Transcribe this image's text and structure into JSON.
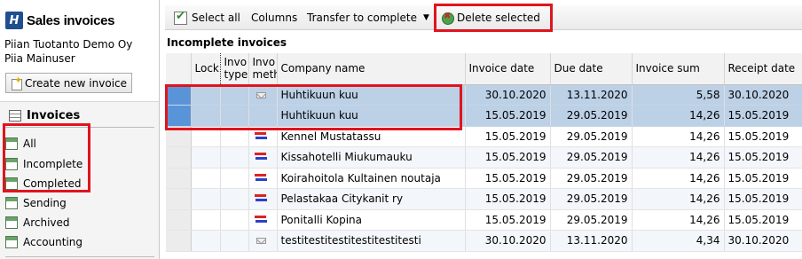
{
  "app": {
    "logo_letter": "H",
    "title": "Sales invoices",
    "company": "Piian Tuotanto Demo Oy",
    "user": "Piia Mainuser",
    "create_button": "Create new invoice"
  },
  "nav": {
    "header": "Invoices",
    "items": [
      {
        "label": "All"
      },
      {
        "label": "Incomplete"
      },
      {
        "label": "Completed"
      },
      {
        "label": "Sending"
      },
      {
        "label": "Archived"
      },
      {
        "label": "Accounting"
      }
    ]
  },
  "toolbar": {
    "select_all": "Select all",
    "columns": "Columns",
    "transfer": "Transfer to complete",
    "delete": "Delete selected"
  },
  "section_title": "Incomplete invoices",
  "grid": {
    "columns": {
      "lock": "Lock",
      "type": "Invo type",
      "method": "Invo meth",
      "company": "Company name",
      "invoice_date": "Invoice date",
      "due_date": "Due date",
      "sum": "Invoice sum",
      "receipt_date": "Receipt date"
    },
    "rows": [
      {
        "method": "envelope-icon",
        "company": "Huhtikuun kuu",
        "invoice_date": "30.10.2020",
        "due_date": "13.11.2020",
        "sum": "5,58",
        "receipt_date": "30.10.2020",
        "selected": true
      },
      {
        "method": "",
        "company": "Huhtikuun kuu",
        "invoice_date": "15.05.2019",
        "due_date": "29.05.2019",
        "sum": "14,26",
        "receipt_date": "15.05.2019",
        "selected": true
      },
      {
        "method": "e-invoice-icon",
        "company": "Kennel Mustatassu",
        "invoice_date": "15.05.2019",
        "due_date": "29.05.2019",
        "sum": "14,26",
        "receipt_date": "15.05.2019",
        "selected": false
      },
      {
        "method": "e-invoice-icon",
        "company": "Kissahotelli Miukumauku",
        "invoice_date": "15.05.2019",
        "due_date": "29.05.2019",
        "sum": "14,26",
        "receipt_date": "15.05.2019",
        "selected": false
      },
      {
        "method": "e-invoice-icon",
        "company": "Koirahoitola Kultainen noutaja",
        "invoice_date": "15.05.2019",
        "due_date": "29.05.2019",
        "sum": "14,26",
        "receipt_date": "15.05.2019",
        "selected": false
      },
      {
        "method": "e-invoice-icon",
        "company": "Pelastakaa Citykanit ry",
        "invoice_date": "15.05.2019",
        "due_date": "29.05.2019",
        "sum": "14,26",
        "receipt_date": "15.05.2019",
        "selected": false
      },
      {
        "method": "e-invoice-icon",
        "company": "Ponitalli Kopina",
        "invoice_date": "15.05.2019",
        "due_date": "29.05.2019",
        "sum": "14,26",
        "receipt_date": "15.05.2019",
        "selected": false
      },
      {
        "method": "envelope-icon",
        "company": "testitestitestitestitestitesti",
        "invoice_date": "30.10.2020",
        "due_date": "13.11.2020",
        "sum": "4,34",
        "receipt_date": "30.10.2020",
        "selected": false
      }
    ]
  },
  "colors": {
    "highlight": "#e0141e",
    "selected_row": "#bcd0e6",
    "selected_marker": "#5a94d8",
    "logo": "#1f4f8f"
  }
}
